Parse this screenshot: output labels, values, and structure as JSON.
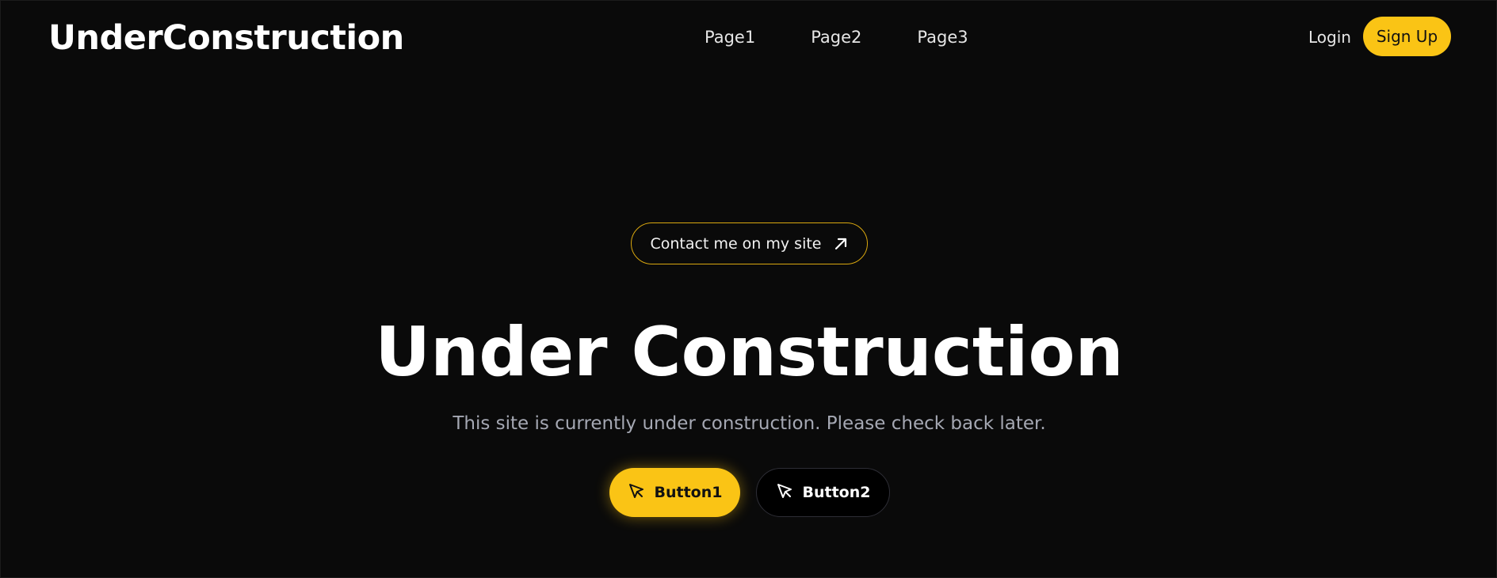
{
  "header": {
    "brand": "UnderConstruction",
    "nav": [
      "Page1",
      "Page2",
      "Page3"
    ],
    "login_label": "Login",
    "signup_label": "Sign Up"
  },
  "hero": {
    "contact_label": "Contact me on my site",
    "title": "Under Construction",
    "subtitle": "This site is currently under construction. Please check back later.",
    "button1_label": "Button1",
    "button2_label": "Button2"
  },
  "icons": {
    "contact": "arrow-up-right-icon",
    "button1": "cursor-pointer-icon",
    "button2": "cursor-pointer-icon"
  },
  "colors": {
    "background": "#0a0a0a",
    "accent": "#fac415",
    "subtitle": "#a5a8b3"
  }
}
